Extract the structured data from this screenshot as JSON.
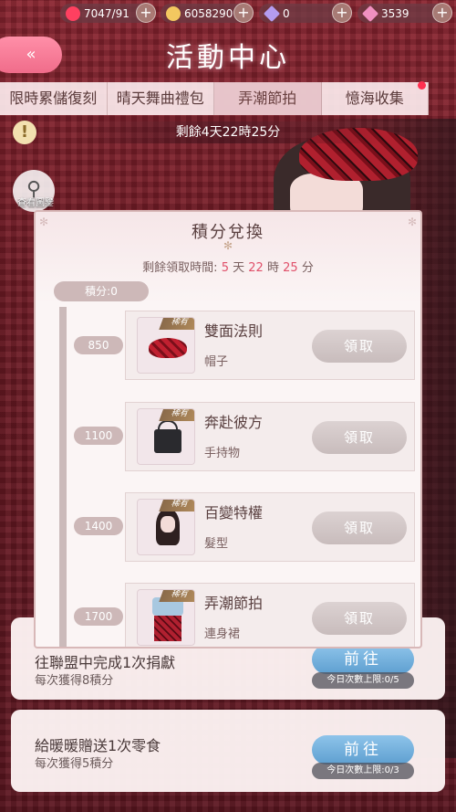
{
  "topbar": {
    "hearts": "7047/91",
    "gold": "6058290",
    "diamond": "0",
    "pink_diamond": "3539"
  },
  "header": {
    "back_label": "«",
    "title": "活動中心"
  },
  "tabs": [
    {
      "label": "限時累儲復刻"
    },
    {
      "label": "晴天舞曲禮包"
    },
    {
      "label": "弄潮節拍"
    },
    {
      "label": "憶海收集"
    }
  ],
  "remaining": "剩餘4天22時25分",
  "gallery_label": "查看圖鑒",
  "popup": {
    "title": "積分兌換",
    "countdown_prefix": "剩餘領取時間:",
    "days": "5",
    "day_unit": "天",
    "hours": "22",
    "hour_unit": "時",
    "minutes": "25",
    "minute_unit": "分",
    "points": "積分:0",
    "rare_label": "稀有",
    "claim_label": "領取",
    "rewards": [
      {
        "threshold": "850",
        "name": "雙面法則",
        "type": "帽子"
      },
      {
        "threshold": "1100",
        "name": "奔赴彼方",
        "type": "手持物"
      },
      {
        "threshold": "1400",
        "name": "百變特權",
        "type": "髮型"
      },
      {
        "threshold": "1700",
        "name": "弄潮節拍",
        "type": "連身裙"
      }
    ]
  },
  "tasks": [
    {
      "title": "往聯盟中完成1次捐獻",
      "reward": "每次獲得8積分",
      "button": "前往",
      "limit": "今日次數上限:0/5"
    },
    {
      "title": "給暖暖贈送1次零食",
      "reward": "每次獲得5積分",
      "button": "前往",
      "limit": "今日次數上限:0/3"
    }
  ],
  "colors": {
    "accent_pink": "#f06c8a",
    "countdown_red": "#e0506a",
    "go_blue": "#5e9fd0",
    "tab_dot": "#ff3050"
  }
}
